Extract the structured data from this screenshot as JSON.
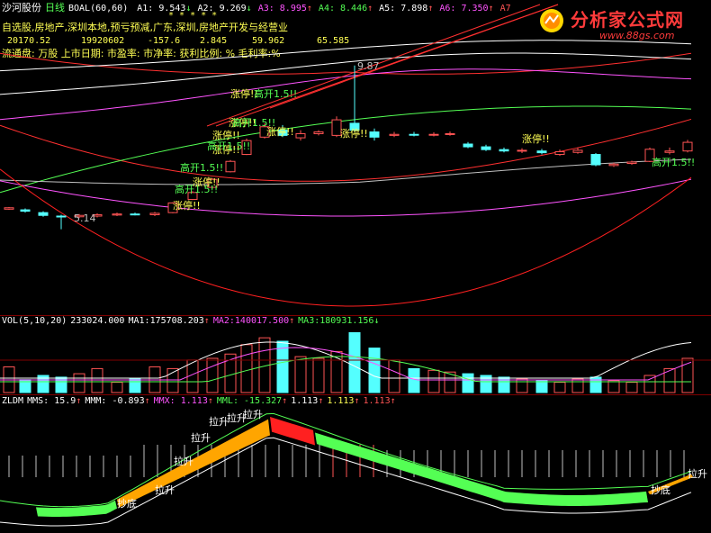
{
  "header": {
    "stock_name": "沙河股份",
    "period": "日线",
    "indicator": "BOAL(60,60)",
    "values": [
      {
        "label": "A1:",
        "value": "9.543",
        "arrow": "↓",
        "color": "#ffffff"
      },
      {
        "label": "A2:",
        "value": "9.269",
        "arrow": "↓",
        "color": "#ffffff"
      },
      {
        "label": "A3:",
        "value": "8.995",
        "arrow": "↑",
        "color": "#ff54ff"
      },
      {
        "label": "A4:",
        "value": "8.446",
        "arrow": "↑",
        "color": "#54ff54"
      },
      {
        "label": "A5:",
        "value": "7.898",
        "arrow": "↑",
        "color": "#ffffff"
      },
      {
        "label": "A6:",
        "value": "7.350",
        "arrow": "↑",
        "color": "#ff54ff"
      },
      {
        "label": "A7",
        "value": "",
        "arrow": "",
        "color": "#ff5454"
      }
    ],
    "stars": "* * * * *"
  },
  "info": {
    "categories": "自选股,房地产,深圳本地,预亏预减,广东,深圳,房地产开发与经营业",
    "row_values": [
      "20170.52",
      "19920602",
      "-157.6",
      "2.845",
      "59.962",
      "65.585"
    ],
    "row_labels": [
      "流通盘:",
      "万股",
      "上市日期:",
      "市盈率:",
      "市净率:",
      "获利比例:",
      "%",
      "毛利率:",
      "%"
    ]
  },
  "logo": {
    "title": "分析家公式网",
    "url": "www.88gs.com"
  },
  "price_annotations": [
    {
      "text": "涨停!!"
    },
    {
      "text": "高开1.5!!"
    },
    {
      "text": "涨停!!"
    },
    {
      "text": "高开1.5!!"
    },
    {
      "text": "涨停!!"
    },
    {
      "text": "高开1.5!!"
    },
    {
      "text": "涨停!!"
    },
    {
      "text": "涨停!!"
    },
    {
      "text": "高开1.5!!"
    },
    {
      "text": "涨停!!"
    },
    {
      "text": "高开1.5!!"
    },
    {
      "text": "涨停!!"
    },
    {
      "text": "涨停!!"
    },
    {
      "text": "高开1.5!!"
    },
    {
      "text": "涨停!!"
    }
  ],
  "price_labels": {
    "high": "9.87",
    "low": "5.14"
  },
  "vol": {
    "title": "VOL(5,10,20)",
    "value": "233024.000",
    "ma1_label": "MA1:",
    "ma1": "175708.203",
    "ma2_label": "MA2:",
    "ma2": "140017.500",
    "ma3_label": "MA3:",
    "ma3": "180931.156"
  },
  "zldm": {
    "title": "ZLDM",
    "mms_label": "MMS:",
    "mms": "15.9",
    "mmm_label": "MMM:",
    "mmm": "-0.893",
    "mmx_label": "MMX:",
    "mmx": "1.113",
    "mml_label": "MML:",
    "mml": "-15.327",
    "v5": "1.113",
    "v6": "1.113",
    "v7": "1.113"
  },
  "zldm_annotations": [
    {
      "text": "抄底"
    },
    {
      "text": "拉升"
    },
    {
      "text": "拉升"
    },
    {
      "text": "拉升"
    },
    {
      "text": "拉升"
    },
    {
      "text": "拉升"
    },
    {
      "text": "拉升"
    },
    {
      "text": "抄底"
    },
    {
      "text": "拉升"
    }
  ],
  "colors": {
    "up": "#ff5454",
    "down": "#54ffff",
    "bg": "#000000",
    "up_arrow": "#ff5454",
    "down_arrow": "#54ff54"
  }
}
